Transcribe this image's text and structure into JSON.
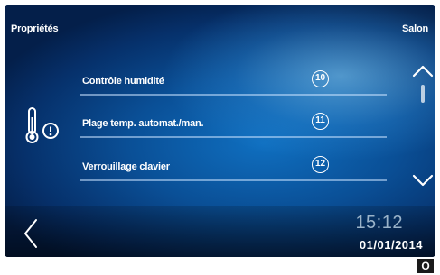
{
  "header": {
    "title": "Propriétés",
    "room": "Salon"
  },
  "menu": {
    "items": [
      {
        "label": "Contrôle humidité",
        "number": "10"
      },
      {
        "label": "Plage temp. automat./man.",
        "number": "11"
      },
      {
        "label": "Verrouillage clavier",
        "number": "12"
      }
    ]
  },
  "icons": {
    "side": "thermometer-warning-icon",
    "scroll_up": "chevron-up-icon",
    "scroll_down": "chevron-down-icon",
    "back": "chevron-left-icon"
  },
  "footer": {
    "time": "15:12",
    "date": "01/01/2014"
  },
  "corner_label": "O",
  "colors": {
    "bg_blue": "#0a4f96",
    "time_gray": "#9ab3c9",
    "divider": "#c8e1ff"
  }
}
